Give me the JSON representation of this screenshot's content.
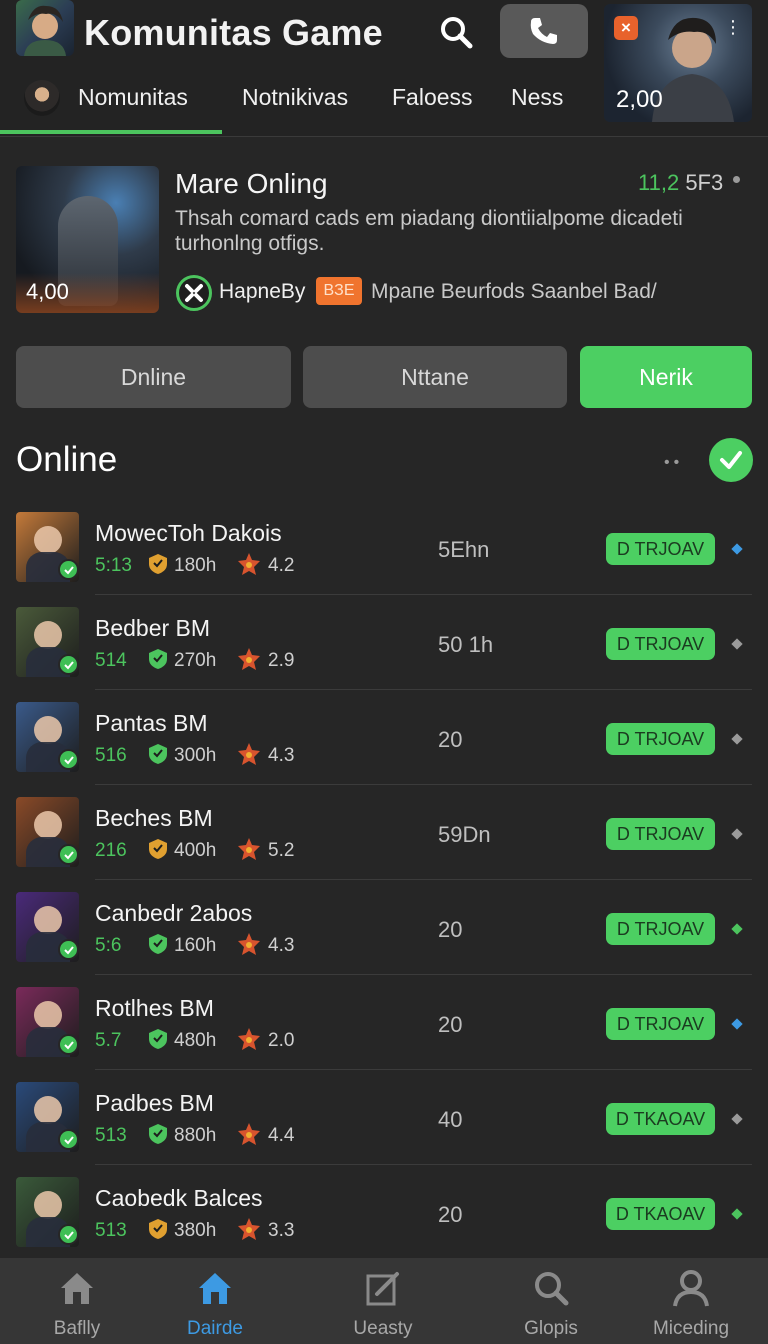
{
  "app": {
    "title": "Komunitas Game"
  },
  "header": {
    "hero_price": "2,00",
    "tabs": [
      {
        "label": "Nomunitas",
        "active": true
      },
      {
        "label": "Notnikivas"
      },
      {
        "label": "Faloess"
      },
      {
        "label": "Ness"
      }
    ]
  },
  "featured": {
    "price": "4,00",
    "title": "Mare Onling",
    "meta_green": "11,2",
    "meta_grey": "5F3",
    "description": "Thsah comard cads em piadang diontiialpome dicadeti turhonlng otfigs.",
    "author": "HapneBy",
    "tag": "BЗE",
    "subtitle": "Mpaпe Beurfods Saanbel Bad/"
  },
  "filters": [
    {
      "label": "Dnline",
      "style": "grey"
    },
    {
      "label": "Nttane",
      "style": "grey"
    },
    {
      "label": "Nerik",
      "style": "green"
    }
  ],
  "section": {
    "title": "Online"
  },
  "rows": [
    {
      "name": "MowecToh Dakois",
      "stat1": "5:13",
      "stat2": "180h",
      "stat3": "4.2",
      "count": "5Ehn",
      "join": "D TRJOAV",
      "avatar_bg": "#c47a3a",
      "shield": "#e0a030",
      "dot": "#3d9ae3"
    },
    {
      "name": "Bedber BM",
      "stat1": "514",
      "stat2": "270h",
      "stat3": "2.9",
      "count": "50 1h",
      "join": "D TRJOAV",
      "avatar_bg": "#4a5a3a",
      "shield": "#4cc45e",
      "dot": "#9a9a9a"
    },
    {
      "name": "Pantas BM",
      "stat1": "516",
      "stat2": "300h",
      "stat3": "4.3",
      "count": "20",
      "join": "D TRJOAV",
      "avatar_bg": "#3a5a8a",
      "shield": "#4cc45e",
      "dot": "#9a9a9a"
    },
    {
      "name": "Beches BM",
      "stat1": "216",
      "stat2": "400h",
      "stat3": "5.2",
      "count": "59Dn",
      "join": "D TRJOAV",
      "avatar_bg": "#8a4a28",
      "shield": "#e0a030",
      "dot": "#9a9a9a"
    },
    {
      "name": "Canbedr 2abos",
      "stat1": "5:6",
      "stat2": "160h",
      "stat3": "4.3",
      "count": "20",
      "join": "D TRJOAV",
      "avatar_bg": "#4a2a7a",
      "shield": "#4cc45e",
      "dot": "#4cc45e"
    },
    {
      "name": "Rotlhes BM",
      "stat1": "5.7",
      "stat2": "480h",
      "stat3": "2.0",
      "count": "20",
      "join": "D TRJOAV",
      "avatar_bg": "#7a2a5a",
      "shield": "#4cc45e",
      "dot": "#3d9ae3"
    },
    {
      "name": "Padbes BM",
      "stat1": "513",
      "stat2": "880h",
      "stat3": "4.4",
      "count": "40",
      "join": "D TKAOAV",
      "avatar_bg": "#2a4a7a",
      "shield": "#4cc45e",
      "dot": "#9a9a9a"
    },
    {
      "name": "Caobedk Balces",
      "stat1": "513",
      "stat2": "380h",
      "stat3": "3.3",
      "count": "20",
      "join": "D TKAOAV",
      "avatar_bg": "#3a5a3a",
      "shield": "#e0a030",
      "dot": "#4cc45e"
    }
  ],
  "bottom_nav": [
    {
      "label": "Baflly",
      "icon": "home-icon"
    },
    {
      "label": "Dairde",
      "icon": "home-icon",
      "active": true
    },
    {
      "label": "Ueasty",
      "icon": "edit-icon"
    },
    {
      "label": "Glopis",
      "icon": "search-icon"
    },
    {
      "label": "Miceding",
      "icon": "profile-icon"
    }
  ],
  "colors": {
    "accent_green": "#4ccf62",
    "active_blue": "#3d9ae3",
    "background": "#262626",
    "tag_orange": "#f0742e"
  }
}
